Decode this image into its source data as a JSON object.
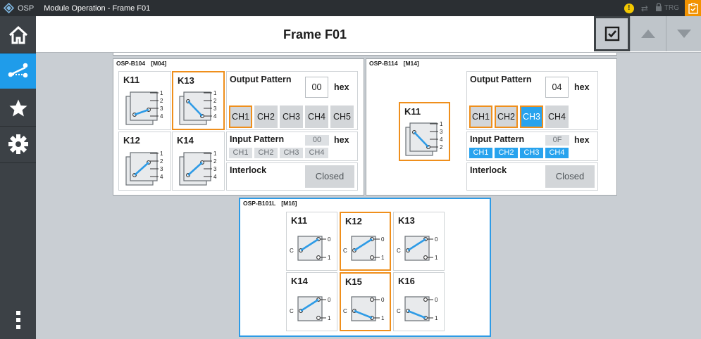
{
  "titlebar": {
    "app": "OSP",
    "title": "Module Operation - Frame F01",
    "trg": "TRG"
  },
  "nav": {
    "items": [
      "home-icon",
      "switch-network-icon",
      "star-icon",
      "gear-icon",
      "more-icon"
    ],
    "active_index": 1
  },
  "header": {
    "title": "Frame F01"
  },
  "panels": {
    "b104": {
      "name": "OSP-B104",
      "slot": "[M04]",
      "relays": [
        {
          "label": "K11",
          "ports": [
            "1",
            "2",
            "3",
            "4"
          ],
          "selected": false
        },
        {
          "label": "K13",
          "ports": [
            "1",
            "2",
            "3",
            "4"
          ],
          "selected": true
        },
        {
          "label": "K12",
          "ports": [
            "1",
            "2",
            "3",
            "4"
          ],
          "selected": false
        },
        {
          "label": "K14",
          "ports": [
            "1",
            "2",
            "3",
            "4"
          ],
          "selected": false
        }
      ],
      "output_pattern": {
        "label": "Output Pattern",
        "value": "00",
        "unit": "hex"
      },
      "output_channels": [
        {
          "label": "CH1",
          "focused": true,
          "active": false
        },
        {
          "label": "CH2",
          "focused": false,
          "active": false
        },
        {
          "label": "CH3",
          "focused": false,
          "active": false
        },
        {
          "label": "CH4",
          "focused": false,
          "active": false
        },
        {
          "label": "CH5",
          "focused": false,
          "active": false
        }
      ],
      "input_pattern": {
        "label": "Input Pattern",
        "value": "00",
        "unit": "hex"
      },
      "input_channels": [
        {
          "label": "CH1",
          "active": false
        },
        {
          "label": "CH2",
          "active": false
        },
        {
          "label": "CH3",
          "active": false
        },
        {
          "label": "CH4",
          "active": false
        }
      ],
      "interlock": {
        "label": "Interlock",
        "state": "Closed"
      }
    },
    "b114": {
      "name": "OSP-B114",
      "slot": "[M14]",
      "relay": {
        "label": "K11",
        "ports": [
          "1",
          "3",
          "4",
          "2"
        ],
        "selected": true
      },
      "output_pattern": {
        "label": "Output Pattern",
        "value": "04",
        "unit": "hex"
      },
      "output_channels": [
        {
          "label": "CH1",
          "focused": true,
          "active": false
        },
        {
          "label": "CH2",
          "focused": true,
          "active": false
        },
        {
          "label": "CH3",
          "focused": true,
          "active": true
        },
        {
          "label": "CH4",
          "focused": false,
          "active": false
        }
      ],
      "input_pattern": {
        "label": "Input Pattern",
        "value": "0F",
        "unit": "hex"
      },
      "input_channels": [
        {
          "label": "CH1",
          "active": true
        },
        {
          "label": "CH2",
          "active": true
        },
        {
          "label": "CH3",
          "active": true
        },
        {
          "label": "CH4",
          "active": true
        }
      ],
      "interlock": {
        "label": "Interlock",
        "state": "Closed"
      }
    },
    "b101l": {
      "name": "OSP-B101L",
      "slot": "[M16]",
      "relays": [
        {
          "label": "K11",
          "common": "C",
          "out0": "0",
          "out1": "1",
          "position": 0,
          "selected": false
        },
        {
          "label": "K12",
          "common": "C",
          "out0": "0",
          "out1": "1",
          "position": 0,
          "selected": true
        },
        {
          "label": "K13",
          "common": "C",
          "out0": "0",
          "out1": "1",
          "position": 0,
          "selected": false
        },
        {
          "label": "K14",
          "common": "C",
          "out0": "0",
          "out1": "1",
          "position": 0,
          "selected": false
        },
        {
          "label": "K15",
          "common": "C",
          "out0": "0",
          "out1": "1",
          "position": 1,
          "selected": true
        },
        {
          "label": "K16",
          "common": "C",
          "out0": "0",
          "out1": "1",
          "position": 1,
          "selected": false
        }
      ]
    }
  },
  "colors": {
    "accent_blue": "#1f9cea",
    "highlight_orange": "#ef8f1c",
    "warning_yellow": "#f3c800",
    "titlebar": "#2b2f33"
  }
}
